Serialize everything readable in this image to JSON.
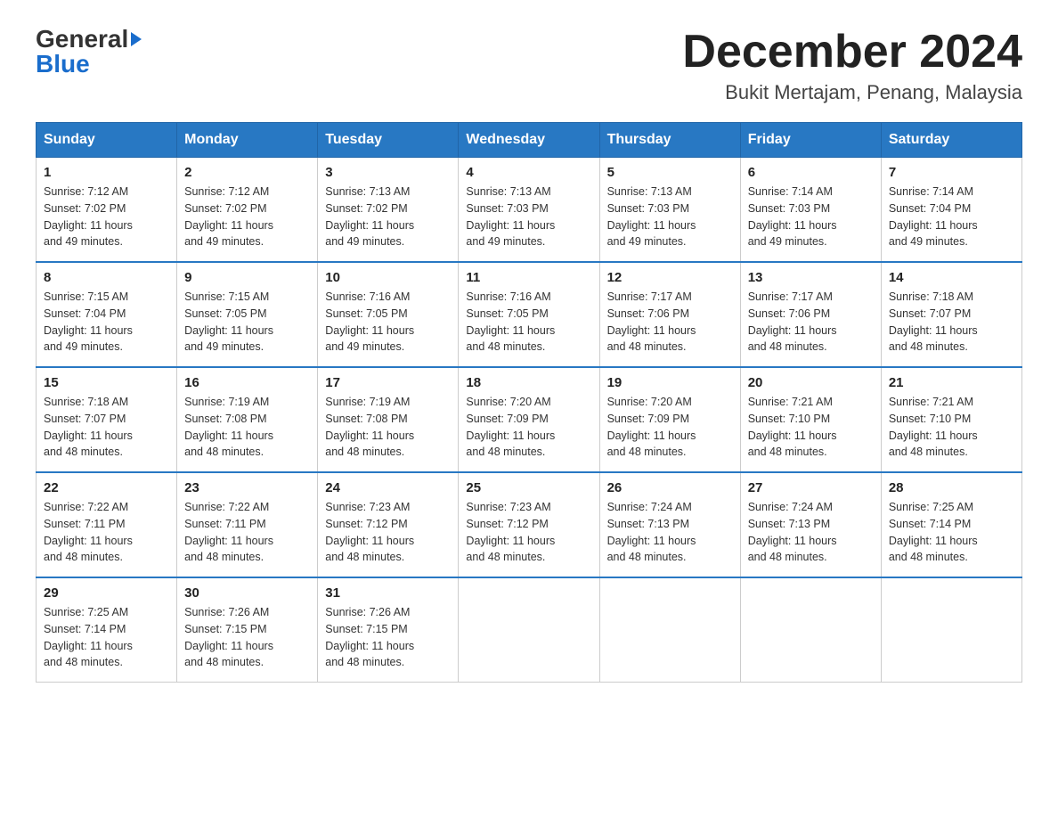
{
  "header": {
    "logo_general": "General",
    "logo_blue": "Blue",
    "month_title": "December 2024",
    "location": "Bukit Mertajam, Penang, Malaysia"
  },
  "days_of_week": [
    "Sunday",
    "Monday",
    "Tuesday",
    "Wednesday",
    "Thursday",
    "Friday",
    "Saturday"
  ],
  "weeks": [
    [
      {
        "day": "1",
        "sunrise": "7:12 AM",
        "sunset": "7:02 PM",
        "daylight": "11 hours and 49 minutes."
      },
      {
        "day": "2",
        "sunrise": "7:12 AM",
        "sunset": "7:02 PM",
        "daylight": "11 hours and 49 minutes."
      },
      {
        "day": "3",
        "sunrise": "7:13 AM",
        "sunset": "7:02 PM",
        "daylight": "11 hours and 49 minutes."
      },
      {
        "day": "4",
        "sunrise": "7:13 AM",
        "sunset": "7:03 PM",
        "daylight": "11 hours and 49 minutes."
      },
      {
        "day": "5",
        "sunrise": "7:13 AM",
        "sunset": "7:03 PM",
        "daylight": "11 hours and 49 minutes."
      },
      {
        "day": "6",
        "sunrise": "7:14 AM",
        "sunset": "7:03 PM",
        "daylight": "11 hours and 49 minutes."
      },
      {
        "day": "7",
        "sunrise": "7:14 AM",
        "sunset": "7:04 PM",
        "daylight": "11 hours and 49 minutes."
      }
    ],
    [
      {
        "day": "8",
        "sunrise": "7:15 AM",
        "sunset": "7:04 PM",
        "daylight": "11 hours and 49 minutes."
      },
      {
        "day": "9",
        "sunrise": "7:15 AM",
        "sunset": "7:05 PM",
        "daylight": "11 hours and 49 minutes."
      },
      {
        "day": "10",
        "sunrise": "7:16 AM",
        "sunset": "7:05 PM",
        "daylight": "11 hours and 49 minutes."
      },
      {
        "day": "11",
        "sunrise": "7:16 AM",
        "sunset": "7:05 PM",
        "daylight": "11 hours and 48 minutes."
      },
      {
        "day": "12",
        "sunrise": "7:17 AM",
        "sunset": "7:06 PM",
        "daylight": "11 hours and 48 minutes."
      },
      {
        "day": "13",
        "sunrise": "7:17 AM",
        "sunset": "7:06 PM",
        "daylight": "11 hours and 48 minutes."
      },
      {
        "day": "14",
        "sunrise": "7:18 AM",
        "sunset": "7:07 PM",
        "daylight": "11 hours and 48 minutes."
      }
    ],
    [
      {
        "day": "15",
        "sunrise": "7:18 AM",
        "sunset": "7:07 PM",
        "daylight": "11 hours and 48 minutes."
      },
      {
        "day": "16",
        "sunrise": "7:19 AM",
        "sunset": "7:08 PM",
        "daylight": "11 hours and 48 minutes."
      },
      {
        "day": "17",
        "sunrise": "7:19 AM",
        "sunset": "7:08 PM",
        "daylight": "11 hours and 48 minutes."
      },
      {
        "day": "18",
        "sunrise": "7:20 AM",
        "sunset": "7:09 PM",
        "daylight": "11 hours and 48 minutes."
      },
      {
        "day": "19",
        "sunrise": "7:20 AM",
        "sunset": "7:09 PM",
        "daylight": "11 hours and 48 minutes."
      },
      {
        "day": "20",
        "sunrise": "7:21 AM",
        "sunset": "7:10 PM",
        "daylight": "11 hours and 48 minutes."
      },
      {
        "day": "21",
        "sunrise": "7:21 AM",
        "sunset": "7:10 PM",
        "daylight": "11 hours and 48 minutes."
      }
    ],
    [
      {
        "day": "22",
        "sunrise": "7:22 AM",
        "sunset": "7:11 PM",
        "daylight": "11 hours and 48 minutes."
      },
      {
        "day": "23",
        "sunrise": "7:22 AM",
        "sunset": "7:11 PM",
        "daylight": "11 hours and 48 minutes."
      },
      {
        "day": "24",
        "sunrise": "7:23 AM",
        "sunset": "7:12 PM",
        "daylight": "11 hours and 48 minutes."
      },
      {
        "day": "25",
        "sunrise": "7:23 AM",
        "sunset": "7:12 PM",
        "daylight": "11 hours and 48 minutes."
      },
      {
        "day": "26",
        "sunrise": "7:24 AM",
        "sunset": "7:13 PM",
        "daylight": "11 hours and 48 minutes."
      },
      {
        "day": "27",
        "sunrise": "7:24 AM",
        "sunset": "7:13 PM",
        "daylight": "11 hours and 48 minutes."
      },
      {
        "day": "28",
        "sunrise": "7:25 AM",
        "sunset": "7:14 PM",
        "daylight": "11 hours and 48 minutes."
      }
    ],
    [
      {
        "day": "29",
        "sunrise": "7:25 AM",
        "sunset": "7:14 PM",
        "daylight": "11 hours and 48 minutes."
      },
      {
        "day": "30",
        "sunrise": "7:26 AM",
        "sunset": "7:15 PM",
        "daylight": "11 hours and 48 minutes."
      },
      {
        "day": "31",
        "sunrise": "7:26 AM",
        "sunset": "7:15 PM",
        "daylight": "11 hours and 48 minutes."
      },
      null,
      null,
      null,
      null
    ]
  ],
  "labels": {
    "sunrise": "Sunrise:",
    "sunset": "Sunset:",
    "daylight": "Daylight:"
  }
}
